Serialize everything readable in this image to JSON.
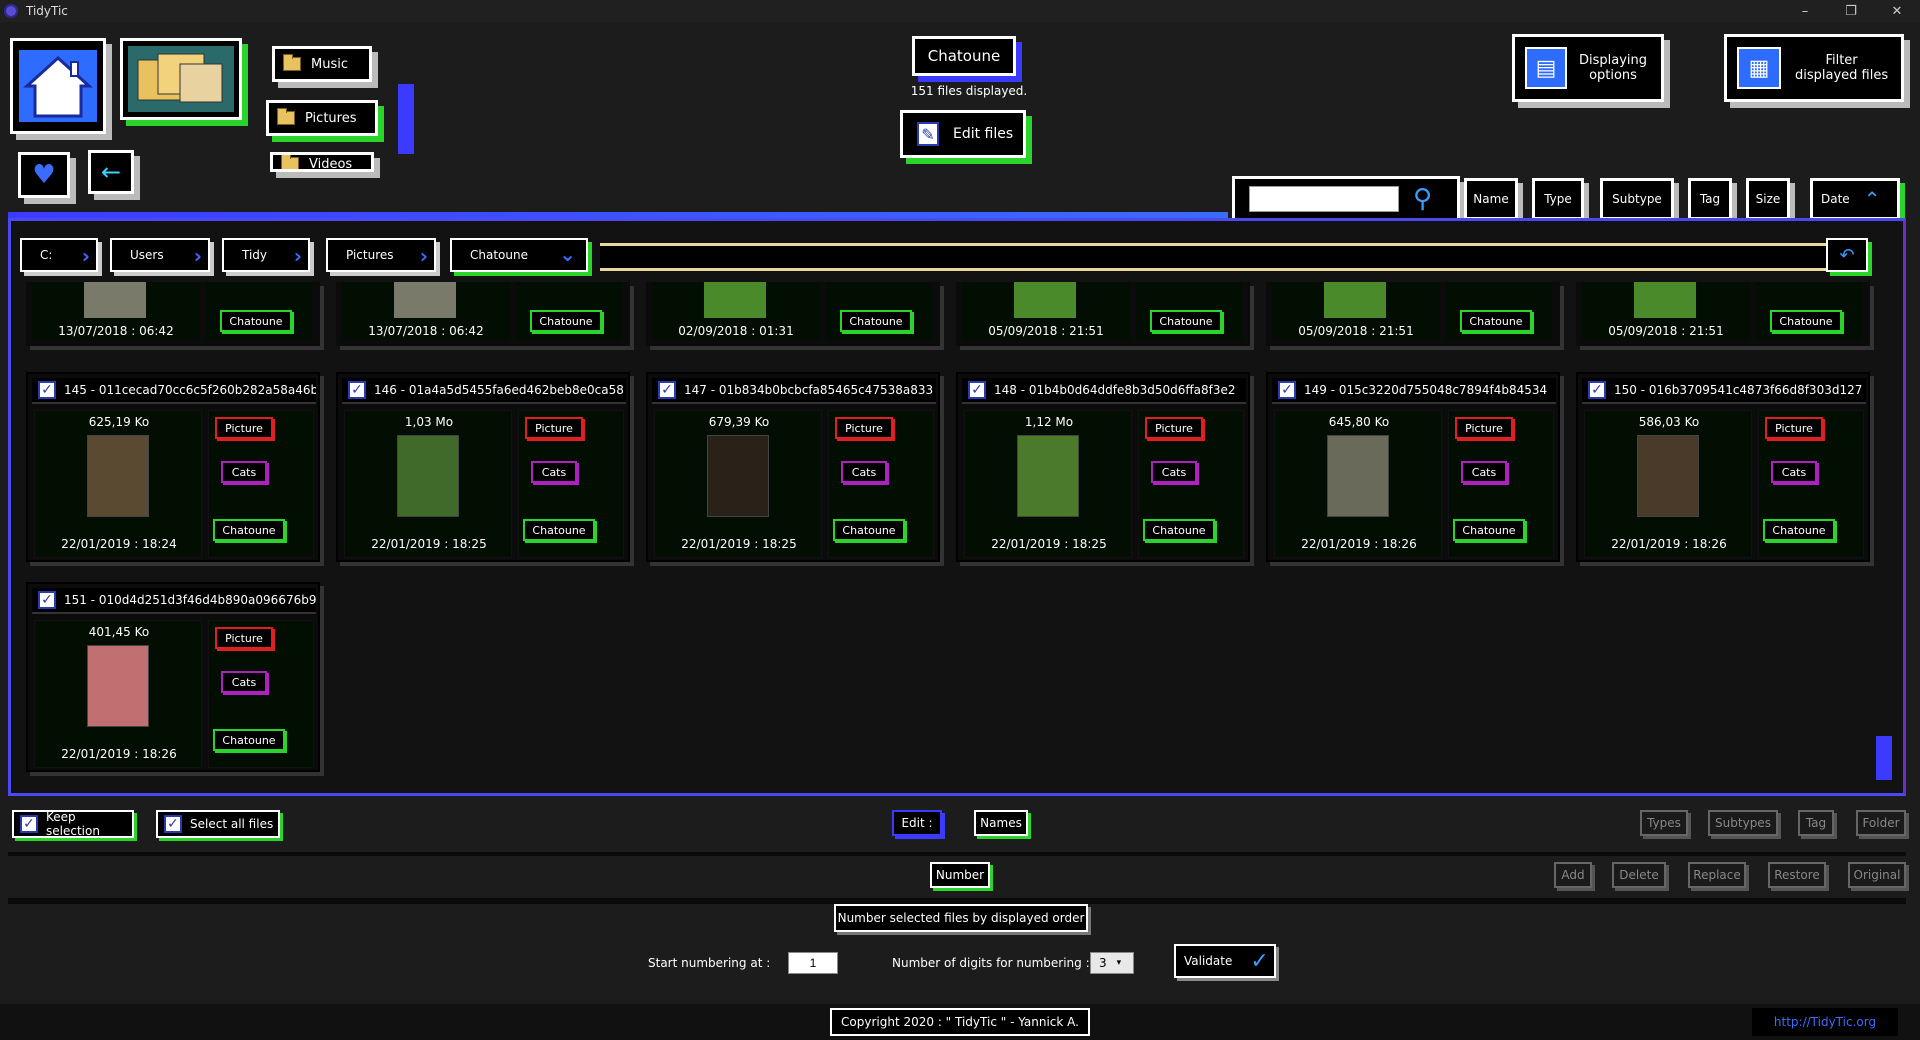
{
  "window": {
    "title": "TidyTic",
    "controls": [
      "–",
      "❐",
      "✕"
    ]
  },
  "nav": {
    "folders": [
      "Music",
      "Pictures",
      "Videos"
    ],
    "current_folder": "Chatoune",
    "files_displayed": "151 files displayed.",
    "edit_files": "Edit files",
    "displaying_options_1": "Displaying",
    "displaying_options_2": "options",
    "filter_files_1": "Filter",
    "filter_files_2": "displayed files"
  },
  "search": {
    "value": ""
  },
  "sort": {
    "buttons": [
      "Name",
      "Type",
      "Subtype",
      "Tag",
      "Size",
      "Date"
    ],
    "active": "Date"
  },
  "breadcrumb": [
    "C:",
    "Users",
    "Tidy",
    "Pictures",
    "Chatoune"
  ],
  "cards_top": [
    {
      "date": "13/07/2018 : 06:42",
      "tag": "Chatoune"
    },
    {
      "date": "13/07/2018 : 06:42",
      "tag": "Chatoune"
    },
    {
      "date": "02/09/2018 : 01:31",
      "tag": "Chatoune"
    },
    {
      "date": "05/09/2018 : 21:51",
      "tag": "Chatoune"
    },
    {
      "date": "05/09/2018 : 21:51",
      "tag": "Chatoune"
    },
    {
      "date": "05/09/2018 : 21:51",
      "tag": "Chatoune"
    }
  ],
  "cards": [
    {
      "name": "145 - 011cecad70cc6c5f260b282a58a46b",
      "size": "625,19 Ko",
      "type": "Picture",
      "subtype": "Cats",
      "tag": "Chatoune",
      "date": "22/01/2019 : 18:24"
    },
    {
      "name": "146 - 01a4a5d5455fa6ed462beb8e0ca58",
      "size": "1,03 Mo",
      "type": "Picture",
      "subtype": "Cats",
      "tag": "Chatoune",
      "date": "22/01/2019 : 18:25"
    },
    {
      "name": "147 - 01b834b0bcbcfa85465c47538a833",
      "size": "679,39 Ko",
      "type": "Picture",
      "subtype": "Cats",
      "tag": "Chatoune",
      "date": "22/01/2019 : 18:25"
    },
    {
      "name": "148 - 01b4b0d64ddfe8b3d50d6ffa8f3e2",
      "size": "1,12 Mo",
      "type": "Picture",
      "subtype": "Cats",
      "tag": "Chatoune",
      "date": "22/01/2019 : 18:25"
    },
    {
      "name": "149 - 015c3220d755048c7894f4b84534",
      "size": "645,80 Ko",
      "type": "Picture",
      "subtype": "Cats",
      "tag": "Chatoune",
      "date": "22/01/2019 : 18:26"
    },
    {
      "name": "150 - 016b3709541c4873f66d8f303d127",
      "size": "586,03 Ko",
      "type": "Picture",
      "subtype": "Cats",
      "tag": "Chatoune",
      "date": "22/01/2019 : 18:26"
    },
    {
      "name": "151 - 010d4d251d3f46d4b890a096676b9",
      "size": "401,45 Ko",
      "type": "Picture",
      "subtype": "Cats",
      "tag": "Chatoune",
      "date": "22/01/2019 : 18:26"
    }
  ],
  "thumb_colors": [
    "#5a4a32",
    "#3f6a2a",
    "#2a2218",
    "#4a7a2a",
    "#6a6a5a",
    "#4a3a2a",
    "#c07070"
  ],
  "bottom": {
    "keep_selection": "Keep selection",
    "select_all": "Select all files",
    "edit_label": "Edit :",
    "names": "Names",
    "types": "Types",
    "subtypes": "Subtypes",
    "tag": "Tag",
    "folder": "Folder",
    "number": "Number",
    "add": "Add",
    "delete": "Delete",
    "replace": "Replace",
    "restore": "Restore",
    "original": "Original",
    "number_desc": "Number selected files by displayed order",
    "start_label": "Start numbering at :",
    "start_value": "1",
    "digits_label": "Number of digits for numbering :",
    "digits_value": "3",
    "validate": "Validate"
  },
  "footer": {
    "copyright": "Copyright 2020 : \" TidyTic \" - Yannick A.",
    "link": "http://TidyTic.org"
  }
}
